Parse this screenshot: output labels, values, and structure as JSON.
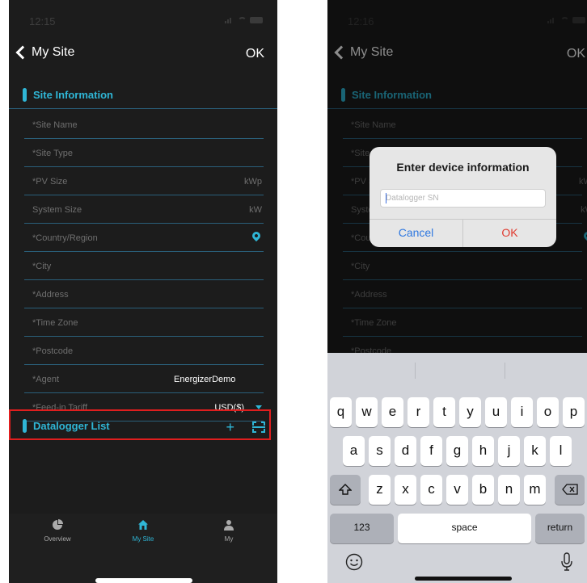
{
  "left": {
    "status_time": "12:15",
    "nav": {
      "back_label": "My Site",
      "ok_label": "OK"
    },
    "site_info": {
      "title": "Site Information"
    },
    "fields": [
      {
        "label": "*Site Name",
        "unit": "",
        "value": ""
      },
      {
        "label": "*Site Type",
        "unit": "",
        "value": ""
      },
      {
        "label": "*PV Size",
        "unit": "kWp",
        "value": ""
      },
      {
        "label": "System Size",
        "unit": "kW",
        "value": ""
      },
      {
        "label": "*Country/Region",
        "unit": "",
        "value": ""
      },
      {
        "label": "*City",
        "unit": "",
        "value": ""
      },
      {
        "label": "*Address",
        "unit": "",
        "value": ""
      },
      {
        "label": "*Time Zone",
        "unit": "",
        "value": ""
      },
      {
        "label": "*Postcode",
        "unit": "",
        "value": ""
      },
      {
        "label": "*Agent",
        "unit": "",
        "value": "EnergizerDemo"
      },
      {
        "label": "*Feed-in Tariff",
        "unit": "",
        "value": "USD($)"
      }
    ],
    "datalogger": {
      "title": "Datalogger List",
      "add_label": "+"
    },
    "tabs": [
      {
        "label": "Overview",
        "icon": "pie-chart-icon"
      },
      {
        "label": "My Site",
        "icon": "home-icon"
      },
      {
        "label": "My",
        "icon": "person-icon"
      }
    ],
    "accent_color": "#2fb6d6",
    "highlight_color": "#e01e1e"
  },
  "right": {
    "status_time": "12:16",
    "nav": {
      "back_label": "My Site",
      "ok_label": "OK"
    },
    "site_info": {
      "title": "Site Information"
    },
    "fields": [
      {
        "label": "*Site Name",
        "unit": ""
      },
      {
        "label": "*Site Type",
        "unit": ""
      },
      {
        "label": "*PV Size",
        "unit": "kWp"
      },
      {
        "label": "System Size",
        "unit": "kW"
      },
      {
        "label": "*Country/Region",
        "unit": ""
      },
      {
        "label": "*City",
        "unit": ""
      },
      {
        "label": "*Address",
        "unit": ""
      },
      {
        "label": "*Time Zone",
        "unit": ""
      },
      {
        "label": "*Postcode",
        "unit": ""
      }
    ],
    "dialog": {
      "title": "Enter device information",
      "input_placeholder": "Datalogger SN",
      "input_value": "",
      "cancel_label": "Cancel",
      "ok_label": "OK"
    },
    "keyboard": {
      "row1": [
        "q",
        "w",
        "e",
        "r",
        "t",
        "y",
        "u",
        "i",
        "o",
        "p"
      ],
      "row2": [
        "a",
        "s",
        "d",
        "f",
        "g",
        "h",
        "j",
        "k",
        "l"
      ],
      "row3": [
        "z",
        "x",
        "c",
        "v",
        "b",
        "n",
        "m"
      ],
      "numbers_label": "123",
      "space_label": "space",
      "return_label": "return",
      "shift_icon": "shift-icon",
      "backspace_icon": "backspace-icon",
      "emoji_icon": "emoji-icon",
      "mic_icon": "microphone-icon"
    }
  }
}
